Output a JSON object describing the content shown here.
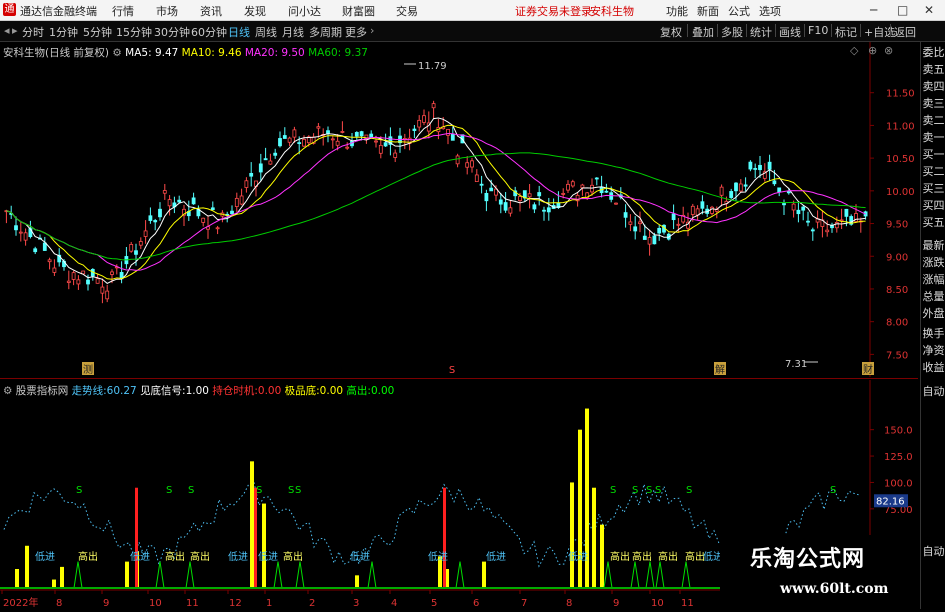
{
  "titlebar": {
    "app_title": "通达信金融终端",
    "menu": [
      "行情",
      "市场",
      "资讯",
      "发现",
      "问小达",
      "财富圈",
      "交易"
    ],
    "notice": "证券交易未登录",
    "stock_name": "安科生物",
    "right_menu": [
      "功能",
      "新面",
      "公式",
      "选项"
    ],
    "window_buttons": [
      "─",
      "□",
      "✕"
    ]
  },
  "toolbar": {
    "periods": [
      "分时",
      "1分钟",
      "5分钟",
      "15分钟",
      "30分钟",
      "60分钟",
      "日线",
      "周线",
      "月线",
      "多周期",
      "更多"
    ],
    "active_period": "日线",
    "tools": [
      "复权",
      "叠加",
      "多股",
      "统计",
      "画线",
      "F10",
      "标记",
      "+自选",
      "返回"
    ]
  },
  "main_chart": {
    "legend_title": "安科生物(日线 前复权)",
    "ma_labels": [
      "MA5: 9.47",
      "MA10: 9.46",
      "MA20: 9.50",
      "MA60: 9.37"
    ],
    "ma_colors": [
      "#ffffff",
      "#ffff00",
      "#ff33ff",
      "#00cc00"
    ],
    "y_ticks": [
      "11.50",
      "11.00",
      "10.50",
      "10.00",
      "9.50",
      "9.00",
      "8.50",
      "8.00",
      "7.50"
    ],
    "high_label": "11.79",
    "low_label": "7.31",
    "markers": [
      "测",
      "S",
      "解",
      "财"
    ]
  },
  "indicator": {
    "legend_title": "股票指标网",
    "items": [
      {
        "label": "走势线:",
        "value": "60.27",
        "color": "#4fc3f7"
      },
      {
        "label": "见底信号:",
        "value": "1.00",
        "color": "#ffffff"
      },
      {
        "label": "持仓时机:",
        "value": "0.00",
        "color": "#ff3333"
      },
      {
        "label": "极品底:",
        "value": "0.00",
        "color": "#ffff00"
      },
      {
        "label": "高出:",
        "value": "0.00",
        "color": "#00ff00"
      }
    ],
    "y_ticks": [
      "150.0",
      "125.0",
      "100.0",
      "75.00"
    ],
    "current_value": "82.16",
    "signal_labels": [
      "低进",
      "高出",
      "S"
    ]
  },
  "x_axis": [
    "2022年",
    "8",
    "9",
    "10",
    "11",
    "12",
    "1",
    "2",
    "3",
    "4",
    "5",
    "6",
    "7",
    "8",
    "9",
    "10",
    "11"
  ],
  "sidebar": [
    "委比",
    "卖五",
    "卖四",
    "卖三",
    "卖二",
    "卖一",
    "买一",
    "买二",
    "买三",
    "买四",
    "买五",
    "最新",
    "涨跌",
    "涨幅",
    "总量",
    "外盘",
    "换手",
    "净资",
    "收益",
    "自动",
    "自动"
  ],
  "watermark": {
    "title": "乐淘公式网",
    "url": "www.60lt.com"
  },
  "chart_data": {
    "type": "candlestick",
    "title": "安科生物(日线 前复权)",
    "ylim": [
      7.2,
      12.0
    ],
    "monthly_close": [
      {
        "x": "2022-07",
        "y": 9.7
      },
      {
        "x": "2022-08",
        "y": 8.8
      },
      {
        "x": "2022-09",
        "y": 8.6
      },
      {
        "x": "2022-10",
        "y": 9.9
      },
      {
        "x": "2022-11",
        "y": 9.5
      },
      {
        "x": "2022-12",
        "y": 10.7
      },
      {
        "x": "2023-01",
        "y": 10.9
      },
      {
        "x": "2023-02",
        "y": 10.6
      },
      {
        "x": "2023-03",
        "y": 11.2
      },
      {
        "x": "2023-04",
        "y": 9.9
      },
      {
        "x": "2023-05",
        "y": 9.8
      },
      {
        "x": "2023-06",
        "y": 10.2
      },
      {
        "x": "2023-07",
        "y": 9.3
      },
      {
        "x": "2023-08",
        "y": 9.7
      },
      {
        "x": "2023-09",
        "y": 10.4
      },
      {
        "x": "2023-10",
        "y": 9.4
      },
      {
        "x": "2023-11",
        "y": 9.5
      }
    ]
  }
}
